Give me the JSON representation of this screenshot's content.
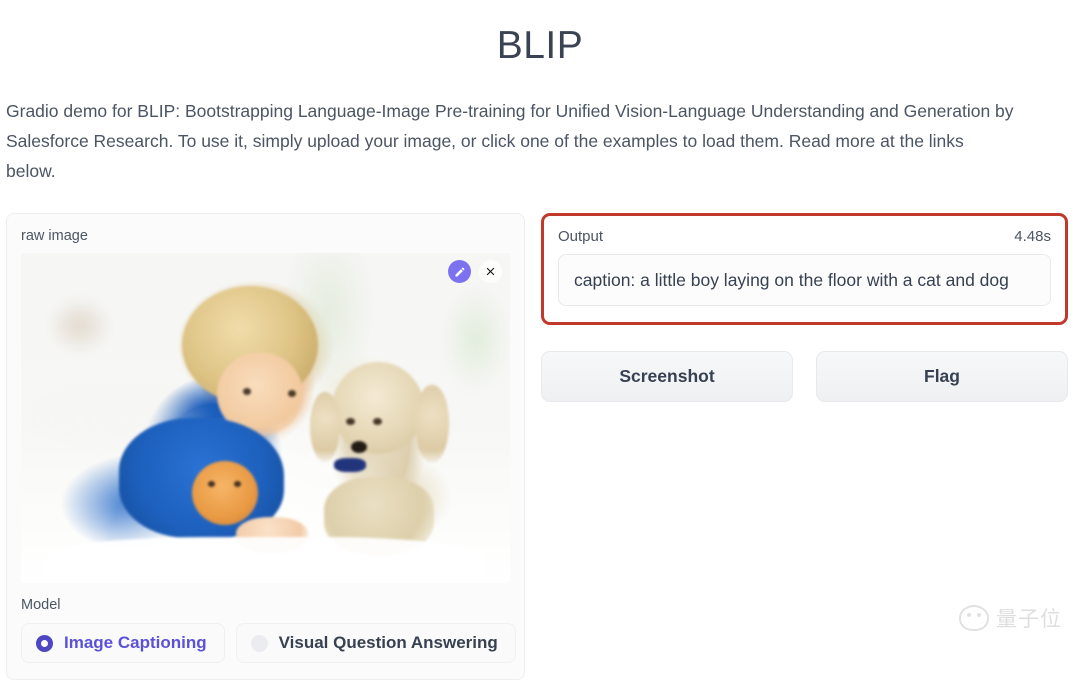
{
  "header": {
    "title": "BLIP",
    "description": "Gradio demo for BLIP: Bootstrapping Language-Image Pre-training for Unified Vision-Language Understanding and Generation by Salesforce Research. To use it, simply upload your image, or click one of the examples to load them. Read more at the links below."
  },
  "input_panel": {
    "image_label": "raw image",
    "image_alt": "A blond curly-haired boy in a blue shirt lying on a white rug with an orange kitten and a cream cocker spaniel puppy",
    "edit_icon": "pencil-icon",
    "clear_icon": "close-x-icon",
    "model_label": "Model",
    "options": [
      {
        "label": "Image Captioning",
        "selected": true
      },
      {
        "label": "Visual Question Answering",
        "selected": false
      }
    ]
  },
  "output_panel": {
    "label": "Output",
    "duration": "4.48s",
    "value": "caption: a little boy laying on the floor with a cat and dog",
    "highlight_color": "#c0392b"
  },
  "actions": {
    "screenshot_label": "Screenshot",
    "flag_label": "Flag"
  },
  "watermark": {
    "text": "量子位",
    "icon": "cat-face-logo-icon"
  },
  "colors": {
    "accent_purple": "#5b51d8",
    "title_text": "#3b4252",
    "body_text": "#4b5563",
    "highlight_red": "#c0392b"
  }
}
